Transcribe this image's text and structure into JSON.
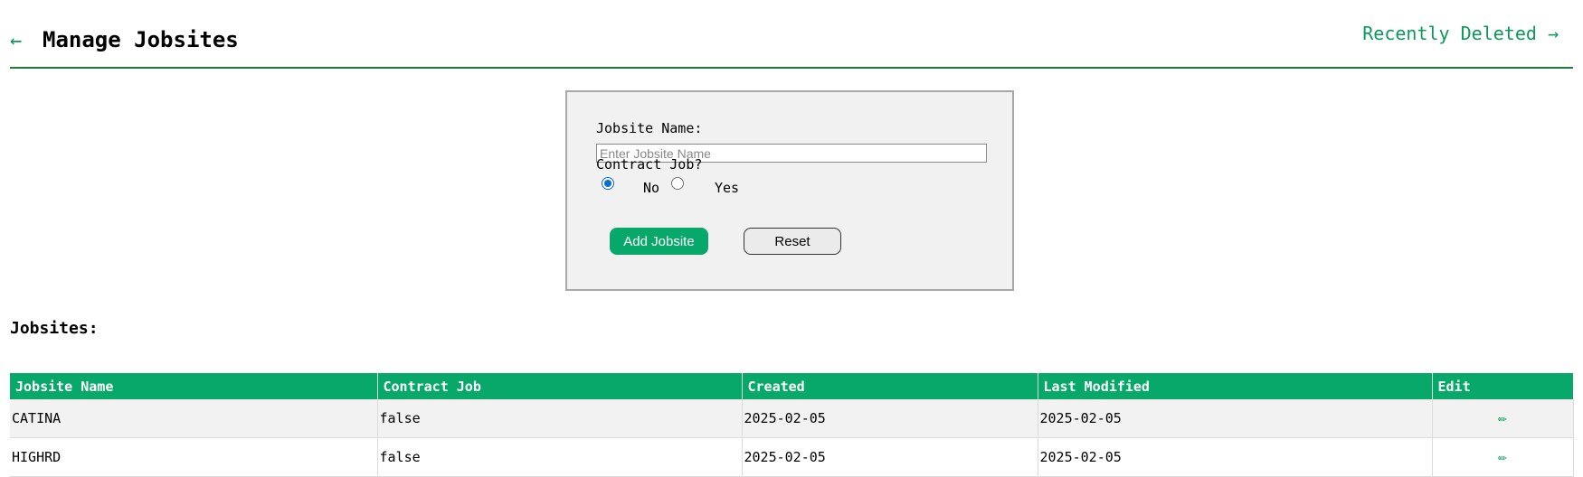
{
  "header": {
    "back_icon": "←",
    "title": "Manage Jobsites",
    "recently_deleted_link": "Recently Deleted →"
  },
  "form": {
    "name_label": "Jobsite Name:",
    "name_value": "",
    "name_placeholder": "Enter Jobsite Name",
    "contract_label": "Contract Job?",
    "contract_options": [
      {
        "label": "No",
        "checked": true
      },
      {
        "label": "Yes",
        "checked": false
      }
    ],
    "add_button": "Add Jobsite",
    "reset_button": "Reset"
  },
  "jobsites": {
    "title": "Jobsites:",
    "columns": [
      "Jobsite Name",
      "Contract Job",
      "Created",
      "Last Modified",
      "Edit"
    ],
    "rows": [
      {
        "name": "CATINA",
        "contract": "false",
        "created": "2025-02-05",
        "modified": "2025-02-05",
        "edit_icon": "✏"
      },
      {
        "name": "HIGHRD",
        "contract": "false",
        "created": "2025-02-05",
        "modified": "2025-02-05",
        "edit_icon": "✏"
      }
    ]
  },
  "colors": {
    "accent": "#08a86a",
    "header_rule": "#1f7a3d",
    "row_alt": "#f2f2f2"
  }
}
